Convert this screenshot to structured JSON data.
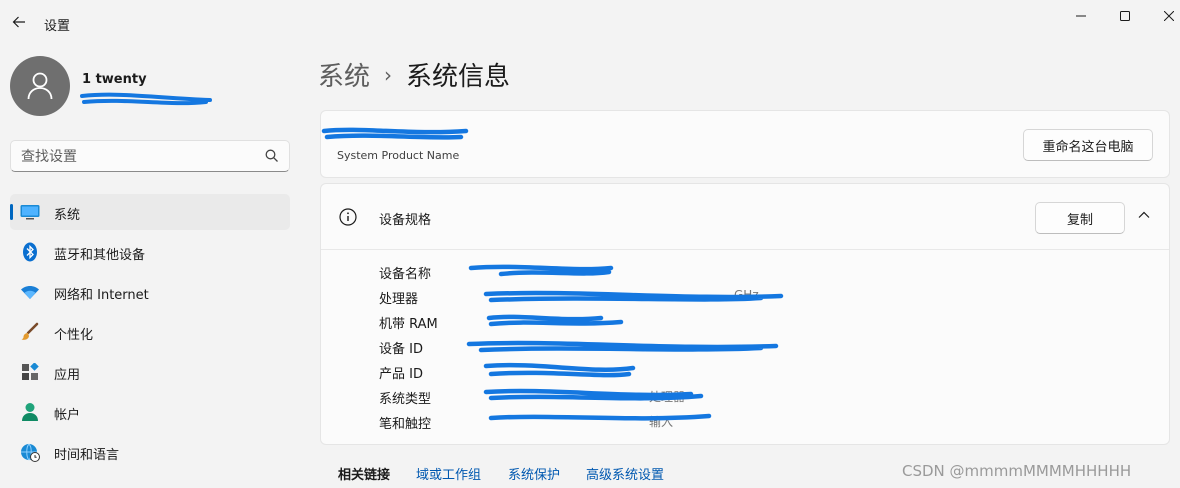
{
  "window": {
    "title": "设置"
  },
  "profile": {
    "name": "1 twenty"
  },
  "search": {
    "placeholder": "查找设置"
  },
  "nav": {
    "items": [
      {
        "label": "系统",
        "icon": "monitor-icon",
        "active": true
      },
      {
        "label": "蓝牙和其他设备",
        "icon": "bluetooth-icon"
      },
      {
        "label": "网络和 Internet",
        "icon": "wifi-icon"
      },
      {
        "label": "个性化",
        "icon": "brush-icon"
      },
      {
        "label": "应用",
        "icon": "apps-icon"
      },
      {
        "label": "帐户",
        "icon": "person-icon"
      },
      {
        "label": "时间和语言",
        "icon": "globe-clock-icon"
      }
    ]
  },
  "breadcrumb": {
    "parent": "系统",
    "separator": "›",
    "current": "系统信息"
  },
  "device_card": {
    "subtitle": "System Product Name",
    "rename_label": "重命名这台电脑"
  },
  "specs": {
    "title": "设备规格",
    "copy_label": "复制",
    "rows": [
      {
        "label": "设备名称",
        "value": ""
      },
      {
        "label": "处理器",
        "value": "GHz"
      },
      {
        "label": "机带 RAM",
        "value": ""
      },
      {
        "label": "设备 ID",
        "value": ""
      },
      {
        "label": "产品 ID",
        "value": ""
      },
      {
        "label": "系统类型",
        "value": "处理器"
      },
      {
        "label": "笔和触控",
        "value": "输入"
      }
    ]
  },
  "related": {
    "title": "相关链接",
    "links": [
      "域或工作组",
      "系统保护",
      "高级系统设置"
    ]
  },
  "watermark": "CSDN @mmmmMMMMHHHHH",
  "colors": {
    "accent": "#0067c0",
    "link": "#0058b0",
    "redaction": "#1477e0"
  }
}
